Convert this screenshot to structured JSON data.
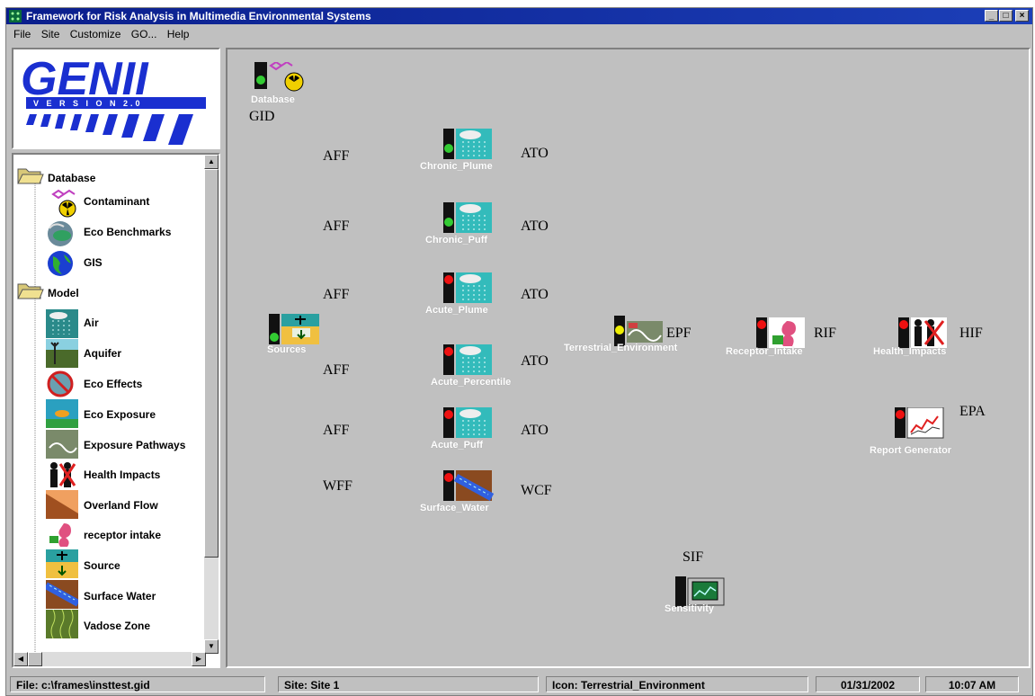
{
  "window": {
    "title": "Framework for Risk Analysis in Multimedia Environmental Systems"
  },
  "menu": [
    "File",
    "Site",
    "Customize",
    "GO...",
    "Help"
  ],
  "logo": {
    "name": "GENII",
    "version": "V E R S I O N  2.0"
  },
  "tree": {
    "groups": [
      {
        "label": "Database",
        "items": [
          "Contaminant",
          "Eco Benchmarks",
          "GIS"
        ]
      },
      {
        "label": "Model",
        "items": [
          "Air",
          "Aquifer",
          "Eco Effects",
          "Eco Exposure",
          "Exposure Pathways",
          "Health Impacts",
          "Overland Flow",
          "receptor intake",
          "Source",
          "Surface Water",
          "Vadose Zone"
        ]
      }
    ]
  },
  "canvas": {
    "modules": {
      "database": "Database",
      "chronic_plume": "Chronic_Plume",
      "chronic_puff": "Chronic_Puff",
      "acute_plume": "Acute_Plume",
      "acute_percentile": "Acute_Percentile",
      "acute_puff": "Acute_Puff",
      "surface_water": "Surface_Water",
      "sources": "Sources",
      "terrestrial": "Terrestrial_Environment",
      "receptor_intake": "Receptor_Intake",
      "health_impacts": "Health_Impacts",
      "report_generator": "Report Generator",
      "sensitivity": "Sensitivity"
    },
    "connections": {
      "gid": "GID",
      "aff1": "AFF",
      "aff2": "AFF",
      "aff3": "AFF",
      "aff4": "AFF",
      "aff5": "AFF",
      "wff": "WFF",
      "ato1": "ATO",
      "ato2": "ATO",
      "ato3": "ATO",
      "ato4": "ATO",
      "ato5": "ATO",
      "wcf": "WCF",
      "epf": "EPF",
      "rif": "RIF",
      "hif": "HIF",
      "epa": "EPA",
      "sif": "SIF"
    }
  },
  "status": {
    "file": "File: c:\\frames\\insttest.gid",
    "site": "Site: Site 1",
    "icon": "Icon: Terrestrial_Environment",
    "date": "01/31/2002",
    "time": "10:07 AM"
  },
  "colors": {
    "title_bar": "#0a1e8c",
    "light_green": "#33cc33",
    "light_red": "#ee1111",
    "light_yellow": "#eeee00",
    "module_bg": "#33bbbb"
  }
}
